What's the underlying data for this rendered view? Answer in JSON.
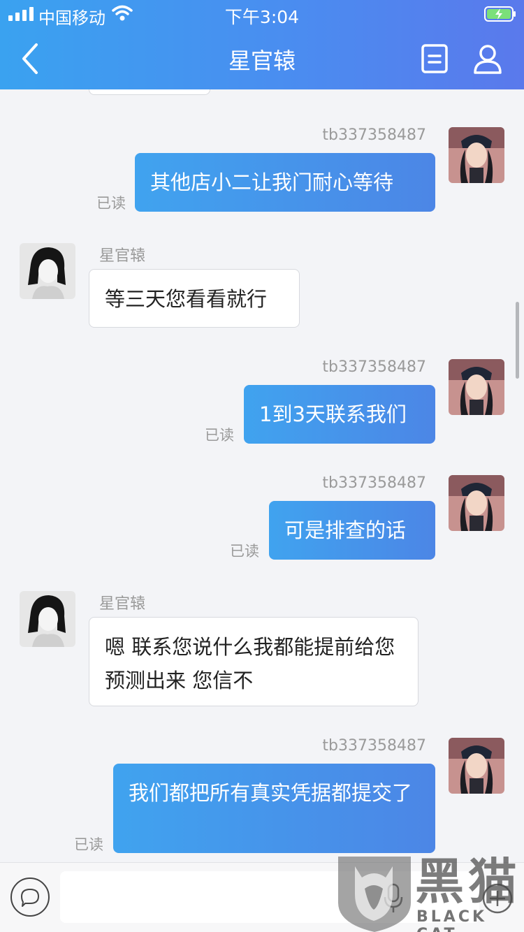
{
  "status_bar": {
    "carrier": "中国移动",
    "time": "下午3:04"
  },
  "nav": {
    "title": "星官辕"
  },
  "messages": [
    {
      "side": "out",
      "sender": "tb337358487",
      "text": "其他店小二让我门耐心等待",
      "read": "已读"
    },
    {
      "side": "in",
      "sender": "星官辕",
      "text": "等三天您看看就行"
    },
    {
      "side": "out",
      "sender": "tb337358487",
      "text": "1到3天联系我们",
      "read": "已读"
    },
    {
      "side": "out",
      "sender": "tb337358487",
      "text": "可是排查的话",
      "read": "已读"
    },
    {
      "side": "in",
      "sender": "星官辕",
      "text": "嗯 联系您说什么我都能提前给您预测出来 您信不"
    },
    {
      "side": "out",
      "sender": "tb337358487",
      "text": "我们都把所有真实凭据都提交了",
      "read": "已读"
    }
  ],
  "watermark": {
    "main": "黑猫",
    "sub": "BLACK CAT"
  },
  "colors": {
    "header_start": "#3aa2f0",
    "header_end": "#5a79ec",
    "bubble_out": "#4c86e6",
    "background": "#f3f4f7"
  }
}
